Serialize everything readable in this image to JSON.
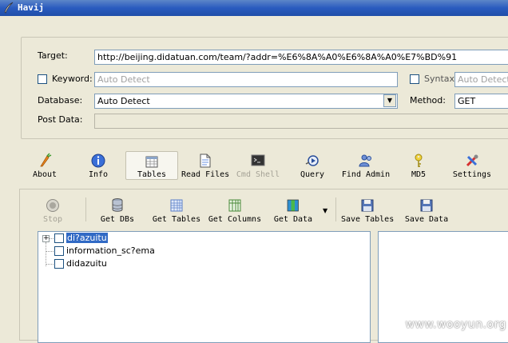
{
  "window": {
    "title": "Havij"
  },
  "form": {
    "target_label": "Target:",
    "target_value": "http://beijing.didatuan.com/team/?addr=%E6%8A%A0%E6%8A%A0%E7%BD%91",
    "keyword_label": "Keyword:",
    "keyword_placeholder": "Auto Detect",
    "syntax_label": "Syntax:",
    "syntax_placeholder": "Auto Detect",
    "database_label": "Database:",
    "database_value": "Auto Detect",
    "method_label": "Method:",
    "method_value": "GET",
    "postdata_label": "Post Data:",
    "postdata_value": ""
  },
  "main_toolbar": {
    "about": "About",
    "info": "Info",
    "tables": "Tables",
    "read_files": "Read Files",
    "cmd_shell": "Cmd Shell",
    "query": "Query",
    "find_admin": "Find Admin",
    "md5": "MD5",
    "settings": "Settings"
  },
  "tables_toolbar": {
    "stop": "Stop",
    "get_dbs": "Get DBs",
    "get_tables": "Get Tables",
    "get_columns": "Get Columns",
    "get_data": "Get Data",
    "save_tables": "Save Tables",
    "save_data": "Save Data"
  },
  "tree": {
    "items": [
      {
        "label": "di?azuitu"
      },
      {
        "label": "information_sc?ema"
      },
      {
        "label": "didazuitu"
      }
    ]
  },
  "watermark": "www.wooyun.org",
  "colors": {
    "titlebar": "#2a5bbf",
    "window_bg": "#ece9d8",
    "selection": "#316ac5"
  }
}
